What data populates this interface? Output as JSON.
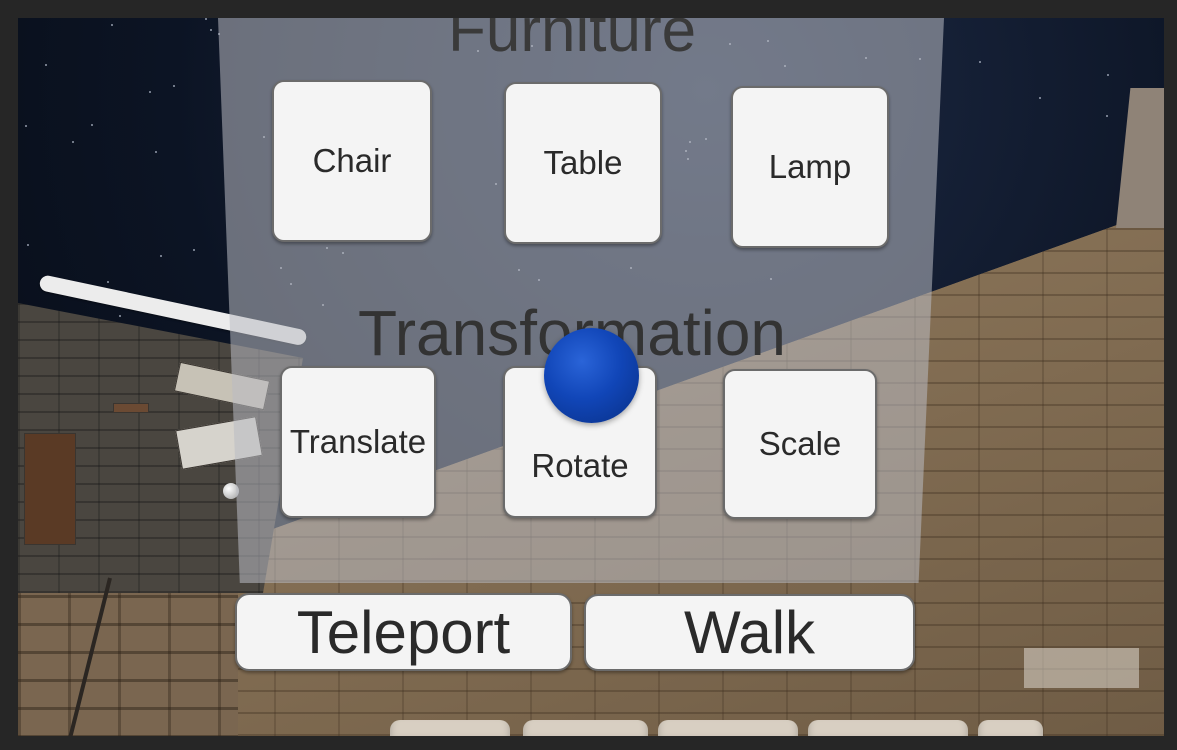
{
  "sections": {
    "furniture_title": "Furniture",
    "transformation_title": "Transformation"
  },
  "furniture_buttons": {
    "chair": "Chair",
    "table": "Table",
    "lamp": "Lamp"
  },
  "transformation_buttons": {
    "translate": "Translate",
    "rotate": "Rotate",
    "scale": "Scale"
  },
  "navigation_buttons": {
    "teleport": "Teleport",
    "walk": "Walk"
  },
  "colors": {
    "pointer": "#1146b8",
    "button_face": "#f4f4f4",
    "panel": "rgba(185,188,195,0.55)"
  }
}
